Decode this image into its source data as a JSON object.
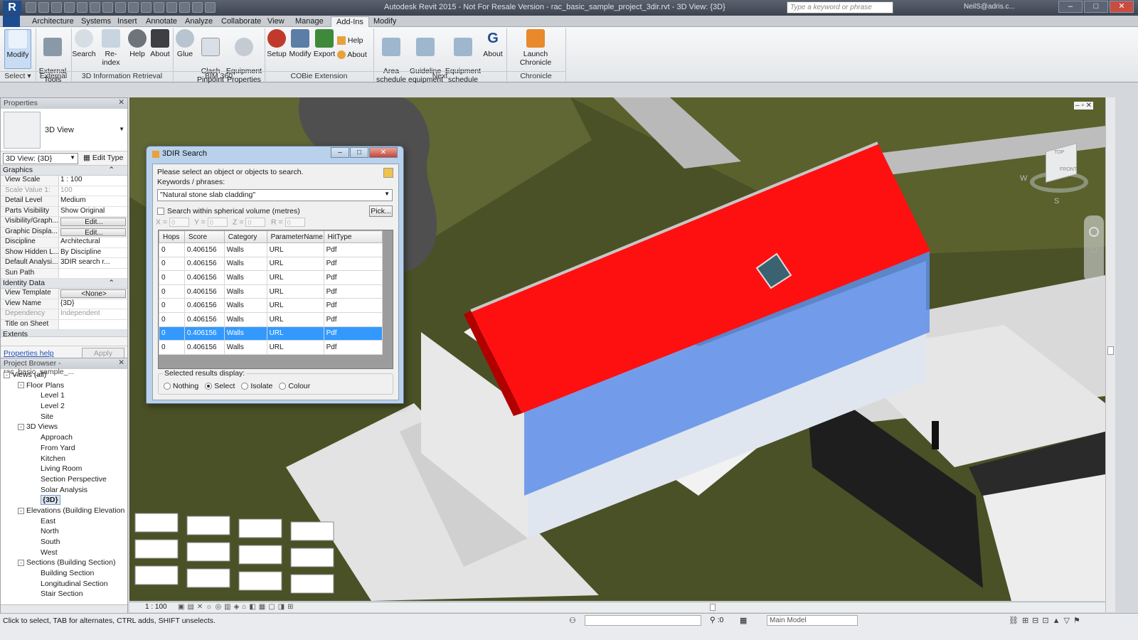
{
  "titlebar": {
    "logo": "R",
    "title": "Autodesk Revit 2015 -  Not For Resale Version  -  rac_basic_sample_project_3dir.rvt - 3D View: {3D}",
    "search_placeholder": "Type a keyword or phrase",
    "user": "NeilS@adris.c..."
  },
  "tabs": [
    "Architecture",
    "Systems",
    "Insert",
    "Annotate",
    "Analyze",
    "Collaborate",
    "View",
    "Manage",
    "Add-Ins",
    "Modify"
  ],
  "ribbon": {
    "buttons": [
      {
        "label": "Modify",
        "icon": "cursor-icon"
      },
      {
        "label": "External\nTools",
        "icon": "wrench-icon"
      },
      {
        "label": "Search",
        "icon": "search-icon"
      },
      {
        "label": "Re-index",
        "icon": "pencil-icon"
      },
      {
        "label": "Help",
        "icon": "help-icon"
      },
      {
        "label": "About",
        "icon": "books-icon"
      },
      {
        "label": "Glue",
        "icon": "glue-icon"
      },
      {
        "label": "Clash\nPinpoint",
        "icon": "clash-icon"
      },
      {
        "label": "Equipment\nProperties",
        "icon": "fan-icon"
      },
      {
        "label": "Setup",
        "icon": "gear-icon"
      },
      {
        "label": "Modify",
        "icon": "grid-icon"
      },
      {
        "label": "Export",
        "icon": "export-icon"
      },
      {
        "label": "Help",
        "icon": "help-icon"
      },
      {
        "label": "About",
        "icon": "info-icon"
      },
      {
        "label": "Area\nschedule",
        "icon": "area-icon"
      },
      {
        "label": "Guideline\nequipment",
        "icon": "guideline-icon"
      },
      {
        "label": "Equipment\nschedule",
        "icon": "schedule-icon"
      },
      {
        "label": "About",
        "icon": "g-logo-icon"
      },
      {
        "label": "Launch Chronicle",
        "icon": "chronicle-icon"
      }
    ],
    "groups": [
      "Select",
      "External",
      "3D Information Retrieval",
      "BIM 360",
      "COBie Extension",
      "Next",
      "Chronicle"
    ]
  },
  "properties": {
    "title": "Properties",
    "type_name": "3D View",
    "view_selector": "3D View: {3D}",
    "edit_type": "Edit Type",
    "groups": {
      "graphics": "Graphics",
      "identity": "Identity Data",
      "extents": "Extents"
    },
    "graphics_rows": [
      {
        "k": "View Scale",
        "v": "1 : 100"
      },
      {
        "k": "Scale Value    1:",
        "v": "100",
        "dim": true
      },
      {
        "k": "Detail Level",
        "v": "Medium"
      },
      {
        "k": "Parts Visibility",
        "v": "Show Original"
      },
      {
        "k": "Visibility/Graph...",
        "v": "Edit...",
        "btn": true
      },
      {
        "k": "Graphic Displa...",
        "v": "Edit...",
        "btn": true
      },
      {
        "k": "Discipline",
        "v": "Architectural"
      },
      {
        "k": "Show Hidden L...",
        "v": "By Discipline"
      },
      {
        "k": "Default Analysi...",
        "v": "3DIR search r..."
      },
      {
        "k": "Sun Path",
        "v": ""
      }
    ],
    "identity_rows": [
      {
        "k": "View Template",
        "v": "<None>",
        "btn": true
      },
      {
        "k": "View Name",
        "v": "{3D}"
      },
      {
        "k": "Dependency",
        "v": "Independent",
        "dim": true
      },
      {
        "k": "Title on Sheet",
        "v": ""
      }
    ],
    "help_link": "Properties help",
    "apply": "Apply"
  },
  "browser": {
    "title": "Project Browser - rac_basic_sample_...",
    "items": [
      {
        "label": "Views (all)",
        "level": 0,
        "pm": "-"
      },
      {
        "label": "Floor Plans",
        "level": 1,
        "pm": "-"
      },
      {
        "label": "Level 1",
        "level": 2
      },
      {
        "label": "Level 2",
        "level": 2
      },
      {
        "label": "Site",
        "level": 2
      },
      {
        "label": "3D Views",
        "level": 1,
        "pm": "-"
      },
      {
        "label": "Approach",
        "level": 2
      },
      {
        "label": "From Yard",
        "level": 2
      },
      {
        "label": "Kitchen",
        "level": 2
      },
      {
        "label": "Living Room",
        "level": 2
      },
      {
        "label": "Section Perspective",
        "level": 2
      },
      {
        "label": "Solar Analysis",
        "level": 2
      },
      {
        "label": "{3D}",
        "level": 2,
        "sel": true
      },
      {
        "label": "Elevations (Building Elevation",
        "level": 1,
        "pm": "-"
      },
      {
        "label": "East",
        "level": 2
      },
      {
        "label": "North",
        "level": 2
      },
      {
        "label": "South",
        "level": 2
      },
      {
        "label": "West",
        "level": 2
      },
      {
        "label": "Sections (Building Section)",
        "level": 1,
        "pm": "-"
      },
      {
        "label": "Building Section",
        "level": 2
      },
      {
        "label": "Longitudinal Section",
        "level": 2
      },
      {
        "label": "Stair Section",
        "level": 2
      }
    ]
  },
  "viewport": {
    "scale": "1 : 100",
    "viewcube_labels": [
      "TOP",
      "FRONT",
      "W",
      "S"
    ]
  },
  "statusbar": {
    "message": "Click to select, TAB for alternates, CTRL adds, SHIFT unselects.",
    "zero": ":0",
    "model": "Main Model"
  },
  "dialog": {
    "title": "3DIR Search",
    "prompt": "Please select an object or objects to search.",
    "keywords_label": "Keywords / phrases:",
    "keywords_value": "\"Natural stone slab cladding\"",
    "spherical_label": "Search within spherical volume (metres)",
    "pick": "Pick...",
    "coords": [
      {
        "k": "X =",
        "v": "0"
      },
      {
        "k": "Y =",
        "v": "0"
      },
      {
        "k": "Z =",
        "v": "0"
      },
      {
        "k": "R =",
        "v": "0"
      }
    ],
    "columns": [
      "Hops",
      "Score",
      "Category",
      "ParameterName",
      "HitType"
    ],
    "rows": [
      [
        "0",
        "0.406156",
        "Walls",
        "URL",
        "Pdf"
      ],
      [
        "0",
        "0.406156",
        "Walls",
        "URL",
        "Pdf"
      ],
      [
        "0",
        "0.406156",
        "Walls",
        "URL",
        "Pdf"
      ],
      [
        "0",
        "0.406156",
        "Walls",
        "URL",
        "Pdf"
      ],
      [
        "0",
        "0.406156",
        "Walls",
        "URL",
        "Pdf"
      ],
      [
        "0",
        "0.406156",
        "Walls",
        "URL",
        "Pdf"
      ],
      [
        "0",
        "0.406156",
        "Walls",
        "URL",
        "Pdf"
      ],
      [
        "0",
        "0.406156",
        "Walls",
        "URL",
        "Pdf"
      ]
    ],
    "selected_row": 6,
    "display_label": "Selected results display:",
    "options": [
      "Nothing",
      "Select",
      "Isolate",
      "Colour"
    ],
    "selected_option": "Select"
  },
  "colors": {
    "roof_highlight": "#ff1010",
    "wall_highlight": "#5f8ee8",
    "grass": "#4b5126",
    "selection": "#3399ff"
  }
}
